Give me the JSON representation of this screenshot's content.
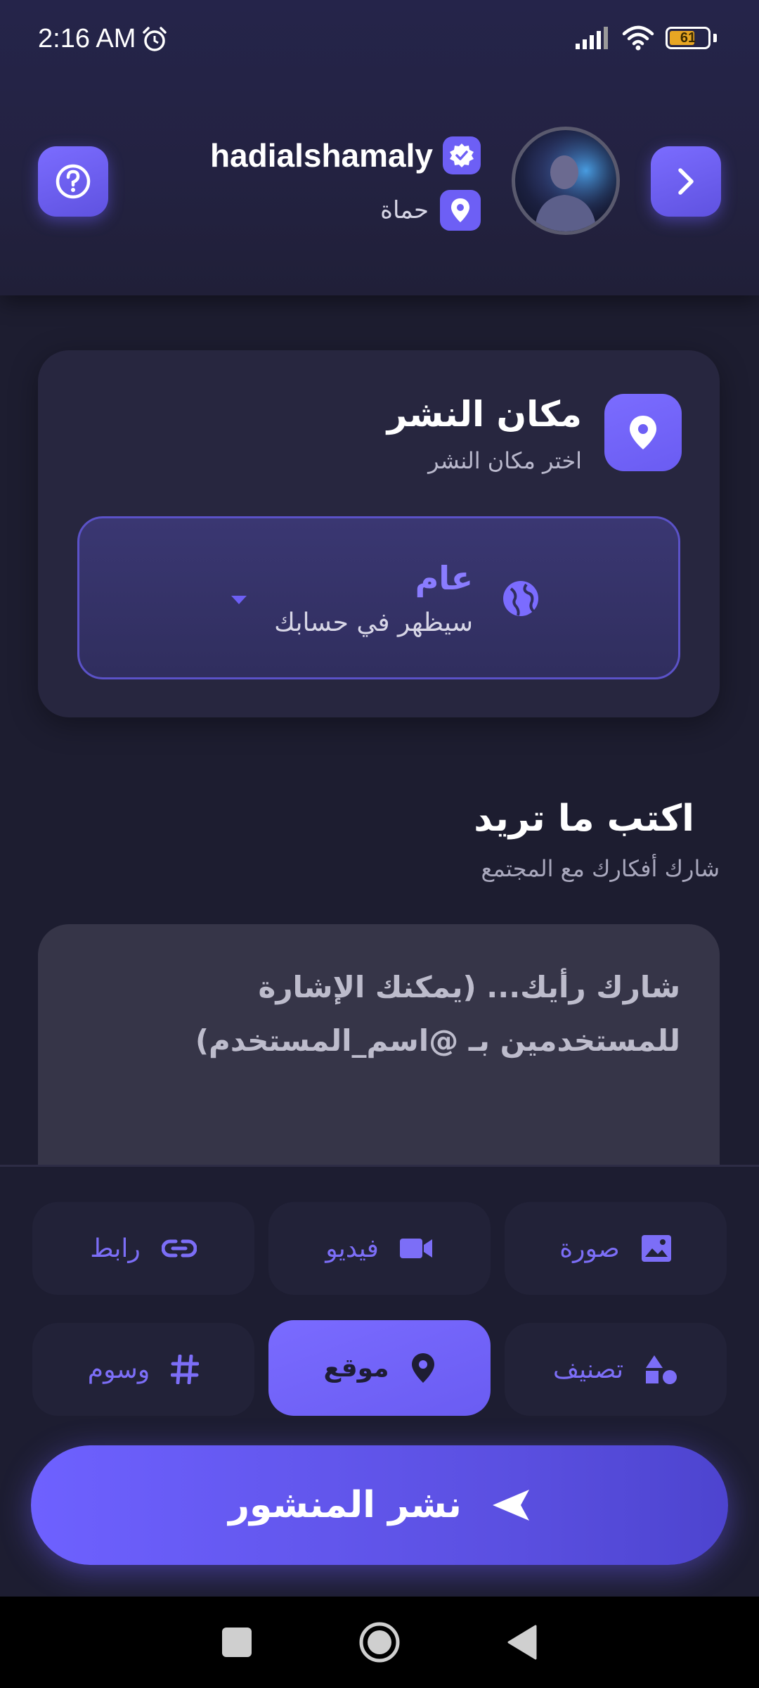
{
  "status": {
    "time": "2:16 AM",
    "battery": "61"
  },
  "profile": {
    "username": "hadialshamaly",
    "location": "حماة"
  },
  "place": {
    "title": "مكان النشر",
    "subtitle": "اختر مكان النشر",
    "privacy_title": "عام",
    "privacy_subtitle": "سيظهر في حسابك"
  },
  "write": {
    "title": "اكتب ما تريد",
    "subtitle": "شارك أفكارك مع المجتمع",
    "placeholder": "شارك رأيك... (يمكنك الإشارة للمستخدمين بـ @اسم_المستخدم)"
  },
  "attachments": {
    "image": "صورة",
    "video": "فيديو",
    "link": "رابط",
    "category": "تصنيف",
    "location": "موقع",
    "tags": "وسوم"
  },
  "publish_label": "نشر المنشور",
  "colors": {
    "accent": "#6d5ff5",
    "background": "#1d1d30",
    "card": "#27263f"
  }
}
